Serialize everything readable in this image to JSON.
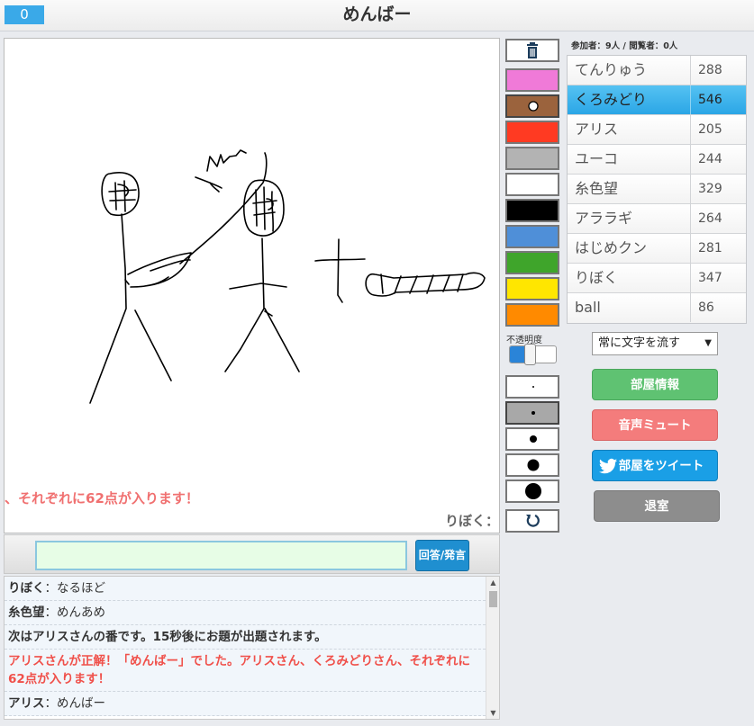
{
  "header": {
    "counter": "0",
    "title": "めんばー"
  },
  "canvas": {
    "flash_message": "、それぞれに62点が入ります！",
    "speaker_label": "りぼく："
  },
  "answer": {
    "input_value": "",
    "submit_label": "回答/発言"
  },
  "chat": [
    {
      "name": "りぼく",
      "text": "：なるほど"
    },
    {
      "name": "糸色望",
      "text": "：めんあめ"
    },
    {
      "system": "次はアリスさんの番です。15秒後にお題が出題されます。"
    },
    {
      "correct": "アリスさんが正解！「めんばー」でした。アリスさん、くろみどりさん、それぞれに62点が入ります！"
    },
    {
      "name": "アリス",
      "text": "：めんばー"
    }
  ],
  "tools": {
    "trash_icon": "trash-icon",
    "colors": [
      "#f07ad8",
      "#9b633d",
      "#ff3a22",
      "#b3b3b3",
      "#ffffff",
      "#000000",
      "#4f8fd8",
      "#3fa52b",
      "#ffe600",
      "#ff8a00"
    ],
    "selected_color": "#9b633d",
    "opacity_label": "不透明度",
    "opacity_value": 0.4,
    "brush_sizes": [
      "xs",
      "s",
      "m",
      "l",
      "xl"
    ],
    "selected_brush": "s",
    "undo_icon": "undo-icon"
  },
  "room": {
    "viewers": "参加者：9人 / 閲覧者：0人",
    "players": [
      {
        "name": "てんりゅう",
        "score": "288"
      },
      {
        "name": "くろみどり",
        "score": "546",
        "active": true
      },
      {
        "name": "アリス",
        "score": "205"
      },
      {
        "name": "ユーコ",
        "score": "244"
      },
      {
        "name": "糸色望",
        "score": "329"
      },
      {
        "name": "アララギ",
        "score": "264"
      },
      {
        "name": "はじめクン",
        "score": "281"
      },
      {
        "name": "りぼく",
        "score": "347"
      },
      {
        "name": "ball",
        "score": "86"
      }
    ],
    "scroll_select": "常に文字を流す",
    "info_button": "部屋情報",
    "mute_button": "音声ミュート",
    "tweet_button": "部屋をツイート",
    "exit_button": "退室"
  }
}
